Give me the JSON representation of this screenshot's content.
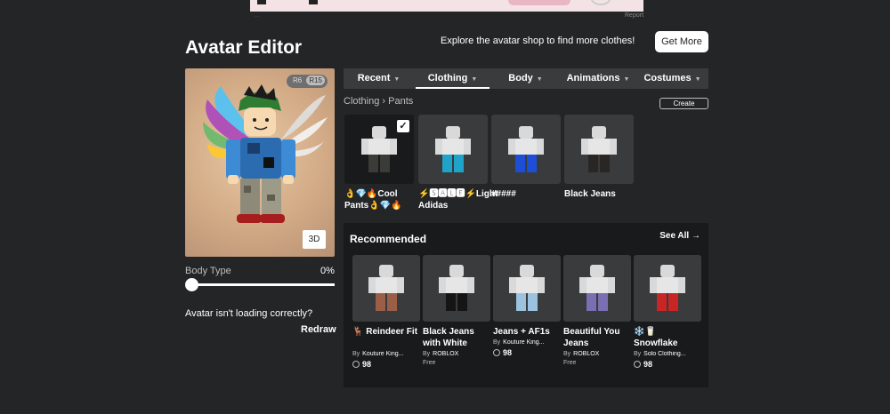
{
  "ad": {
    "report": "Report",
    "caption": "..."
  },
  "header": {
    "title": "Avatar Editor",
    "promo": "Explore the avatar shop to find more clothes!",
    "get_more": "Get More"
  },
  "avatar": {
    "rig_options": [
      "R6",
      "R15"
    ],
    "selected_rig": "R15",
    "view_3d": "3D",
    "body_type_label": "Body Type",
    "body_type_value": "0%",
    "body_type_level": 0,
    "loading_msg": "Avatar isn't loading correctly?",
    "redraw": "Redraw"
  },
  "tabs": [
    {
      "label": "Recent"
    },
    {
      "label": "Clothing"
    },
    {
      "label": "Body"
    },
    {
      "label": "Animations"
    },
    {
      "label": "Costumes"
    }
  ],
  "active_tab": "Clothing",
  "breadcrumb": {
    "parent": "Clothing",
    "separator": "›",
    "current": "Pants"
  },
  "create_label": "Create",
  "inventory": [
    {
      "name": "👌💎🔥Cool Pants👌💎🔥",
      "selected": true,
      "pants_color": "#3b3b38"
    },
    {
      "name": "⚡🆂🅰🅻🅴⚡Light Adidas",
      "selected": false,
      "pants_color": "#1fa3c9"
    },
    {
      "name": "#####",
      "selected": false,
      "pants_color": "#1d4fd6"
    },
    {
      "name": "Black Jeans",
      "selected": false,
      "pants_color": "#2a2624"
    }
  ],
  "recommended": {
    "title": "Recommended",
    "see_all": "See All",
    "items": [
      {
        "name": "🦌 Reindeer Fit",
        "by": "By",
        "creator": "Kouture King...",
        "price": "98",
        "free": false,
        "pants_color": "#9b5f47"
      },
      {
        "name": "Black Jeans with White",
        "by": "By",
        "creator": "ROBLOX",
        "price": "Free",
        "free": true,
        "pants_color": "#151515"
      },
      {
        "name": "Jeans + AF1s",
        "by": "By",
        "creator": "Kouture King...",
        "price": "98",
        "free": false,
        "pants_color": "#9bc3e0"
      },
      {
        "name": "Beautiful You Jeans",
        "by": "By",
        "creator": "ROBLOX",
        "price": "Free",
        "free": true,
        "pants_color": "#7a6fb0"
      },
      {
        "name": "❄️🥛 Snowflake",
        "by": "By",
        "creator": "Solo Clothing...",
        "price": "98",
        "free": false,
        "pants_color": "#c92525"
      }
    ]
  }
}
